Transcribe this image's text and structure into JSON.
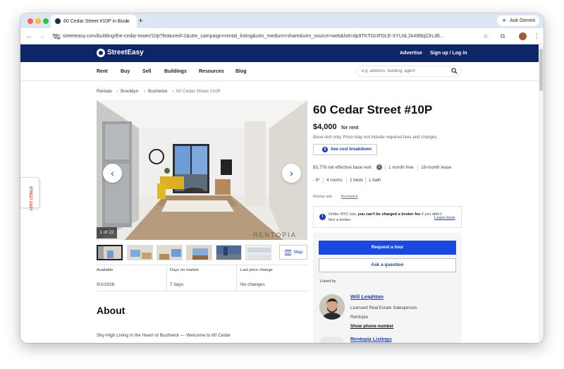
{
  "browser": {
    "tab_title": "60 Cedar Street #10P in Busł",
    "url": "streeteasy.com/building/the-cedar-tower/10p?featured=1&utm_campaign=rental_listing&utm_medium=share&utm_source=web&lstt=dp9TKTOcIFDLE-XYLNL2k496bjClrLd6...",
    "gemini_label": "Ask Gemini",
    "dot_colors": [
      "#ff5f57",
      "#febc2e",
      "#28c840"
    ]
  },
  "site": {
    "logo": "StreetEasy",
    "advertise": "Advertise",
    "signup": "Sign up / Log in",
    "brand_color": "#0e2668"
  },
  "nav": {
    "items": [
      "Rent",
      "Buy",
      "Sell",
      "Buildings",
      "Resources",
      "Blog"
    ],
    "search_placeholder": "e.g. address, building, agent"
  },
  "breadcrumb": [
    "Rentals",
    "Brooklyn",
    "Bushwick",
    "60 Cedar Street #10P"
  ],
  "gallery": {
    "counter": "1 of 22",
    "watermark": "RENTOPIA",
    "map_label": "Map",
    "thumb_count": 7
  },
  "stats": [
    {
      "label": "Available",
      "value": "9/1/2026"
    },
    {
      "label": "Days on market",
      "value": "7 days"
    },
    {
      "label": "Last price change",
      "value": "No changes"
    }
  ],
  "about": {
    "heading": "About",
    "description": "Sky-High Living in the Heart of Bushwick — Welcome to 60 Cedar"
  },
  "listing": {
    "title": "60 Cedar Street #10P",
    "price": "$4,000",
    "price_suffix": "for rent",
    "note": "Base rent only. Price may not include required fees and charges.",
    "cost_button": "See cost breakdown",
    "net_rent": "$3,778 net effective base rent",
    "free": "1 month free",
    "lease": "18-month lease",
    "sqft": "- ft²",
    "rooms": "4 rooms",
    "beds": "2 beds",
    "baths": "1 bath",
    "unit_type": "Rental unit",
    "neighborhood": "Bushwick",
    "broker_prefix": "Under NYC law, ",
    "broker_bold": "you can't be charged a broker fee",
    "broker_suffix": " if you didn't hire a broker.",
    "learn_more": "Learn more",
    "accent_color": "#1a48e0"
  },
  "contact": {
    "tour_button": "Request a tour",
    "ask_button": "Ask a question",
    "listed_by": "Listed by",
    "agent_name": "Will Leighton",
    "agent_role": "Licensed Real Estate Salesperson",
    "agent_firm": "Rentopia",
    "phone_link": "Show phone number",
    "listings_link": "Rentopia Listings"
  },
  "side_widget": "STREET EASY"
}
